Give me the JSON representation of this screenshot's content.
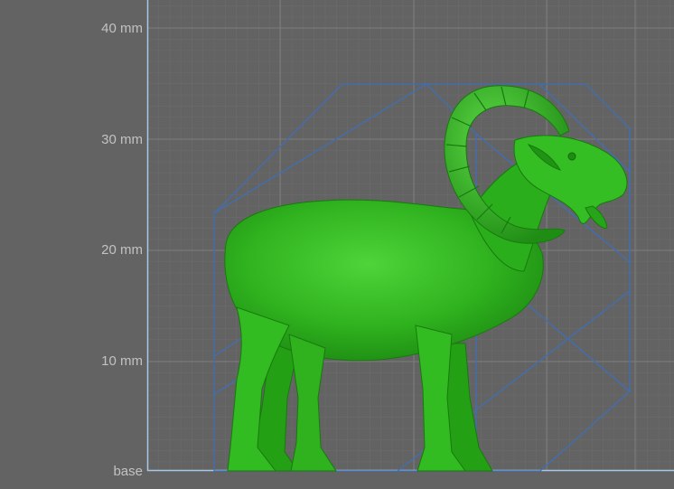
{
  "viewport": {
    "background": "#636363",
    "grid_color": "#7a7a7a",
    "axis_color": "#a9c8e6",
    "bounding_box_color": "#3f6fb5",
    "model_color": "#2fb21e",
    "model": "ram-figurine"
  },
  "ruler": {
    "labels": [
      "40 mm",
      "30 mm",
      "20 mm",
      "10 mm",
      "base"
    ]
  }
}
